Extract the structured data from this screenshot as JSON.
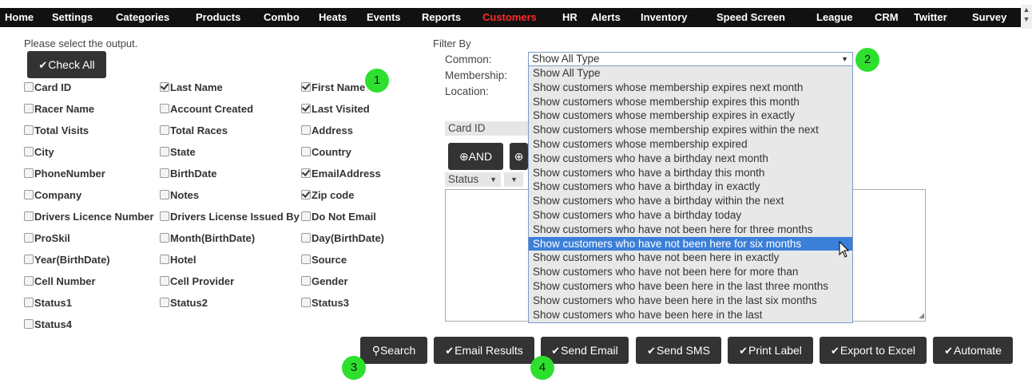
{
  "nav": {
    "items": [
      {
        "label": "Home"
      },
      {
        "label": "Settings"
      },
      {
        "label": "Categories"
      },
      {
        "label": "Products"
      },
      {
        "label": "Combo"
      },
      {
        "label": "Heats"
      },
      {
        "label": "Events"
      },
      {
        "label": "Reports"
      },
      {
        "label": "Customers",
        "active": true
      },
      {
        "label": "HR"
      },
      {
        "label": "Alerts"
      },
      {
        "label": "Inventory"
      },
      {
        "label": "Speed Screen"
      },
      {
        "label": "League"
      },
      {
        "label": "CRM"
      },
      {
        "label": "Twitter"
      },
      {
        "label": "Survey"
      }
    ]
  },
  "output": {
    "instruction": "Please select the output.",
    "check_all_label": "Check All",
    "fields": [
      {
        "label": "Card ID",
        "checked": false
      },
      {
        "label": "Last Name",
        "checked": true
      },
      {
        "label": "First Name",
        "checked": true
      },
      {
        "label": "Racer Name",
        "checked": false
      },
      {
        "label": "Account Created",
        "checked": false
      },
      {
        "label": "Last Visited",
        "checked": true
      },
      {
        "label": "Total Visits",
        "checked": false
      },
      {
        "label": "Total Races",
        "checked": false
      },
      {
        "label": "Address",
        "checked": false
      },
      {
        "label": "City",
        "checked": false
      },
      {
        "label": "State",
        "checked": false
      },
      {
        "label": "Country",
        "checked": false
      },
      {
        "label": "PhoneNumber",
        "checked": false
      },
      {
        "label": "BirthDate",
        "checked": false
      },
      {
        "label": "EmailAddress",
        "checked": true
      },
      {
        "label": "Company",
        "checked": false
      },
      {
        "label": "Notes",
        "checked": false
      },
      {
        "label": "Zip code",
        "checked": true
      },
      {
        "label": "Drivers Licence Number",
        "checked": false
      },
      {
        "label": "Drivers License Issued By",
        "checked": false
      },
      {
        "label": "Do Not Email",
        "checked": false
      },
      {
        "label": "ProSkil",
        "checked": false
      },
      {
        "label": "Month(BirthDate)",
        "checked": false
      },
      {
        "label": "Day(BirthDate)",
        "checked": false
      },
      {
        "label": "Year(BirthDate)",
        "checked": false
      },
      {
        "label": "Hotel",
        "checked": false
      },
      {
        "label": "Source",
        "checked": false
      },
      {
        "label": "Cell Number",
        "checked": false
      },
      {
        "label": "Cell Provider",
        "checked": false
      },
      {
        "label": "Gender",
        "checked": false
      },
      {
        "label": "Status1",
        "checked": false
      },
      {
        "label": "Status2",
        "checked": false
      },
      {
        "label": "Status3",
        "checked": false
      },
      {
        "label": "Status4",
        "checked": false
      }
    ]
  },
  "filter": {
    "title": "Filter By",
    "common_label": "Common:",
    "membership_label": "Membership:",
    "location_label": "Location:",
    "common_value": "Show All Type",
    "options": [
      "Show All Type",
      "Show customers whose membership expires next month",
      "Show customers whose membership expires this month",
      "Show customers whose membership expires in exactly",
      "Show customers whose membership expires within the next",
      "Show customers whose membership expired",
      "Show customers who have a birthday next month",
      "Show customers who have a birthday this month",
      "Show customers who have a birthday in exactly",
      "Show customers who have a birthday within the next",
      "Show customers who have a birthday today",
      "Show customers who have not been here for three months",
      "Show customers who have not been here for six months",
      "Show customers who have not been here in exactly",
      "Show customers who have not been here for more than",
      "Show customers who have been here in the last three months",
      "Show customers who have been here in the last six months",
      "Show customers who have been here in the last"
    ],
    "highlighted_option": "Show customers who have not been here for six months",
    "field_value": "Card ID",
    "and_label": "AND",
    "status_value": "Status"
  },
  "actions": {
    "search": "Search",
    "email_results": "Email Results",
    "send_email": "Send Email",
    "send_sms": "Send SMS",
    "print_label": "Print Label",
    "export_excel": "Export to Excel",
    "automate": "Automate"
  },
  "markers": [
    "1",
    "2",
    "3",
    "4"
  ],
  "colors": {
    "nav_bg": "#111111",
    "active": "#ff2a2a",
    "button": "#333333",
    "highlight": "#3b7fd8",
    "marker": "#2ee02e"
  }
}
